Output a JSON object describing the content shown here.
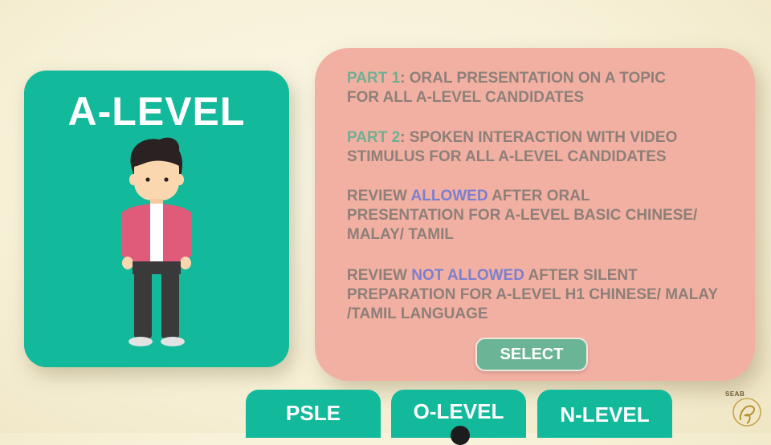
{
  "level_card": {
    "title": "A-LEVEL"
  },
  "info": {
    "blocks": [
      {
        "prefix": "",
        "highlight": "PART 1",
        "suffix": ": ORAL PRESENTATION ON A TOPIC",
        "line2": "FOR ALL A-LEVEL CANDIDATES"
      },
      {
        "prefix": "",
        "highlight": "PART 2",
        "suffix": ": SPOKEN INTERACTION WITH VIDEO",
        "line2": "STIMULUS FOR ALL A-LEVEL CANDIDATES"
      },
      {
        "prefix": "REVIEW ",
        "highlight": "ALLOWED",
        "suffix": " AFTER ORAL",
        "line2": "PRESENTATION FOR A-LEVEL BASIC CHINESE/",
        "line3": "MALAY/ TAMIL"
      },
      {
        "prefix": "REVIEW ",
        "highlight": "NOT ALLOWED",
        "suffix": " AFTER SILENT",
        "line2": "PREPARATION FOR A-LEVEL H1 CHINESE/ MALAY",
        "line3": "/TAMIL LANGUAGE"
      }
    ],
    "select_label": "SELECT"
  },
  "tabs": [
    "PSLE",
    "O-LEVEL",
    "N-LEVEL"
  ],
  "logo": {
    "text": "SEAB"
  },
  "colors": {
    "teal": "#12b99a",
    "salmon": "#f2b0a2",
    "part_highlight": "#6faf93",
    "allowed_highlight": "#7b7fd0",
    "select_button": "#6bb596"
  }
}
